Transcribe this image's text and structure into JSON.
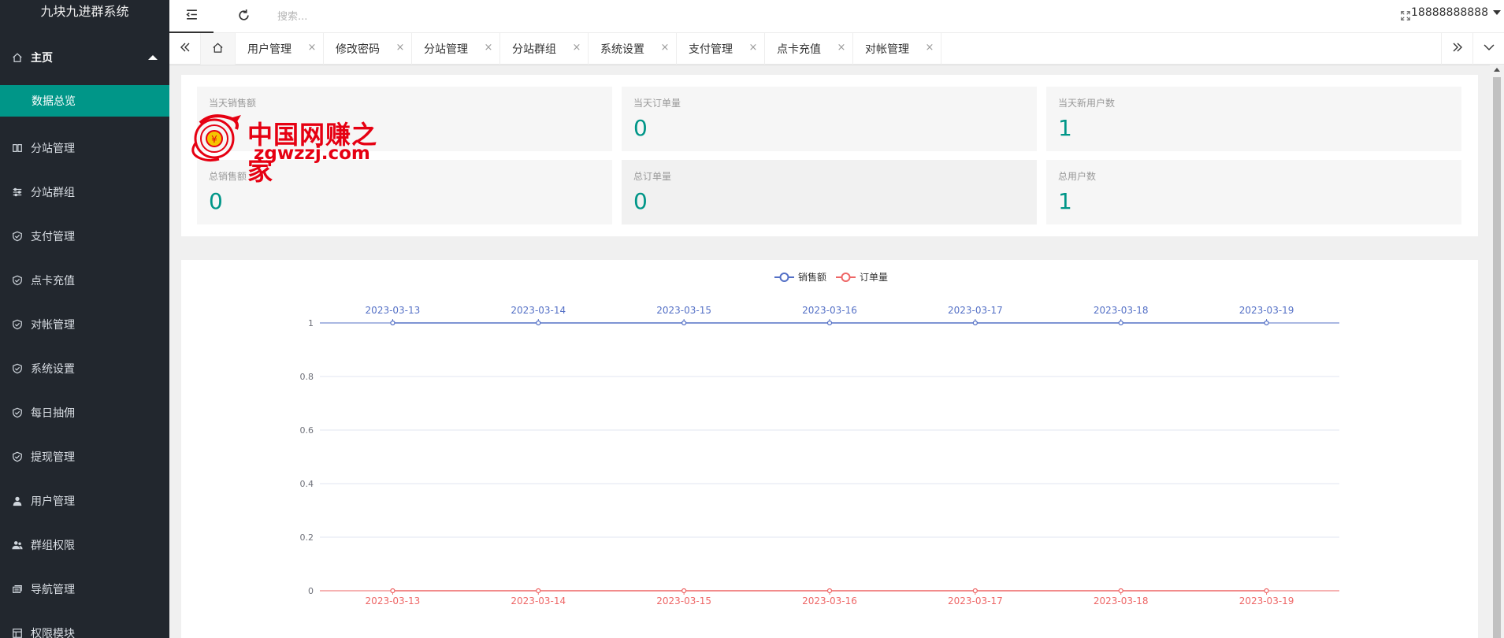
{
  "app": {
    "title": "九块九进群系统"
  },
  "sidebar": {
    "home": {
      "label": "主页",
      "icon": "home-icon"
    },
    "sub": {
      "label": "数据总览"
    },
    "items": [
      {
        "label": "分站管理",
        "icon": "columns-icon"
      },
      {
        "label": "分站群组",
        "icon": "sliders-icon"
      },
      {
        "label": "支付管理",
        "icon": "shield-check-icon"
      },
      {
        "label": "点卡充值",
        "icon": "shield-check-icon"
      },
      {
        "label": "对帐管理",
        "icon": "shield-check-icon"
      },
      {
        "label": "系统设置",
        "icon": "shield-check-icon"
      },
      {
        "label": "每日抽佣",
        "icon": "shield-check-icon"
      },
      {
        "label": "提现管理",
        "icon": "shield-check-icon"
      },
      {
        "label": "用户管理",
        "icon": "user-icon"
      },
      {
        "label": "群组权限",
        "icon": "users-icon"
      },
      {
        "label": "导航管理",
        "icon": "nav-icon"
      },
      {
        "label": "权限模块",
        "icon": "module-icon"
      }
    ]
  },
  "header": {
    "search_placeholder": "搜索...",
    "username": "18888888888"
  },
  "tabs": [
    {
      "label": "用户管理"
    },
    {
      "label": "修改密码"
    },
    {
      "label": "分站管理"
    },
    {
      "label": "分站群组"
    },
    {
      "label": "系统设置"
    },
    {
      "label": "支付管理"
    },
    {
      "label": "点卡充值"
    },
    {
      "label": "对帐管理"
    }
  ],
  "tab_close": "×",
  "stats": [
    {
      "label": "当天销售额",
      "value": ""
    },
    {
      "label": "当天订单量",
      "value": "0"
    },
    {
      "label": "当天新用户数",
      "value": "1"
    },
    {
      "label": "总销售额",
      "value": "0"
    },
    {
      "label": "总订单量",
      "value": "0"
    },
    {
      "label": "总用户数",
      "value": "1"
    }
  ],
  "watermark": {
    "cn": "中国网赚之家",
    "en": "zgwzzj.com"
  },
  "colors": {
    "accent": "#009688",
    "sidebar": "#22272e",
    "series_sales": "#5470c6",
    "series_orders": "#ee6666"
  },
  "chart_data": {
    "type": "line",
    "legend": [
      "销售额",
      "订单量"
    ],
    "legend_position": "top-center",
    "categories": [
      "2023-03-13",
      "2023-03-14",
      "2023-03-15",
      "2023-03-16",
      "2023-03-17",
      "2023-03-18",
      "2023-03-19"
    ],
    "series": [
      {
        "name": "销售额",
        "values": [
          1,
          1,
          1,
          1,
          1,
          1,
          1
        ],
        "color": "#5470c6",
        "xaxis": "top"
      },
      {
        "name": "订单量",
        "values": [
          0,
          0,
          0,
          0,
          0,
          0,
          0
        ],
        "color": "#ee6666",
        "xaxis": "bottom"
      }
    ],
    "yticks": [
      "0",
      "0.2",
      "0.4",
      "0.6",
      "0.8",
      "1"
    ],
    "ylim": [
      0,
      1
    ],
    "grid": true
  }
}
